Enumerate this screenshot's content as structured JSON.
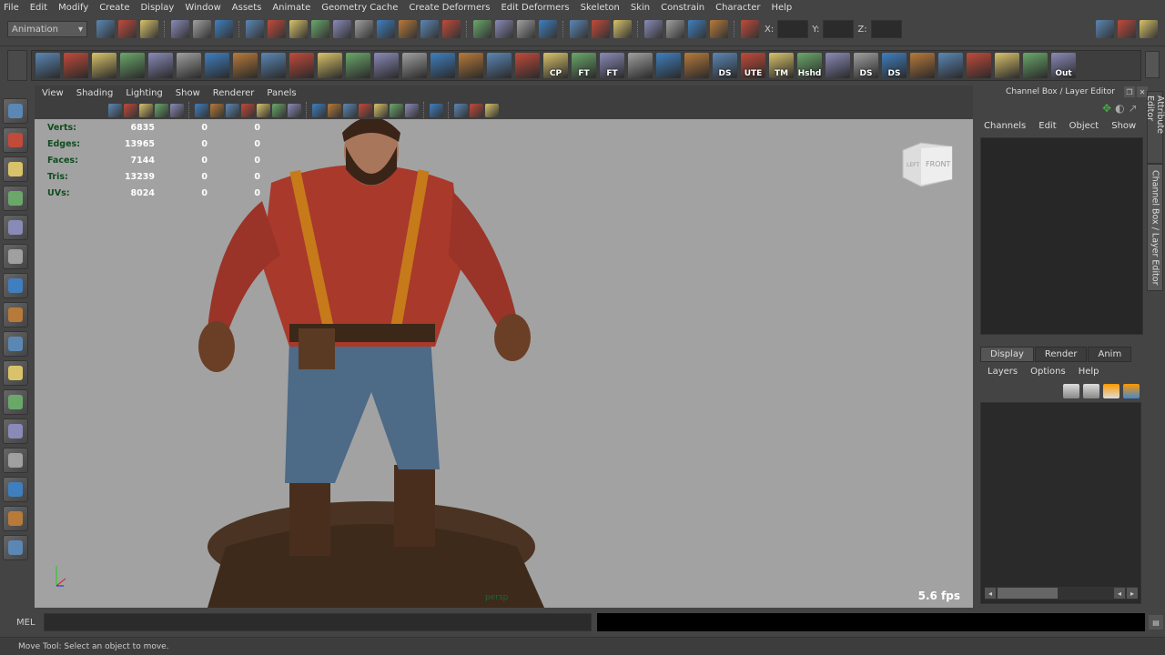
{
  "menubar": [
    "File",
    "Edit",
    "Modify",
    "Create",
    "Display",
    "Window",
    "Assets",
    "Animate",
    "Geometry Cache",
    "Create Deformers",
    "Edit Deformers",
    "Skeleton",
    "Skin",
    "Constrain",
    "Character",
    "Help"
  ],
  "statusline": {
    "menuset": "Animation",
    "icons": [
      "new-scene-icon",
      "open-scene-icon",
      "save-scene-icon",
      "|",
      "select-hierarchy-icon",
      "select-object-icon",
      "select-component-icon",
      "|",
      "snap-grid-icon",
      "snap-curve-icon",
      "snap-point-icon",
      "snap-surface-icon",
      "snap-view-icon",
      "snap-live-icon",
      "snap-vertex-icon",
      "help-query-icon",
      "lock-icon",
      "select-highlight-icon",
      "|",
      "magnet-icon",
      "magnet-curve-icon",
      "magnet-point-icon",
      "magnet-surface-icon",
      "|",
      "input-ops-icon",
      "output-ops-icon",
      "construction-history-icon",
      "|",
      "render-view-icon",
      "render-icon",
      "ipr-render-icon",
      "render-settings-icon",
      "|",
      "transform-field-icon"
    ],
    "x_label": "X:",
    "y_label": "Y:",
    "z_label": "Z:",
    "right_icons": [
      "attribute-editor-toggle-icon",
      "tool-settings-toggle-icon",
      "channel-box-toggle-icon"
    ]
  },
  "shelf": {
    "items": [
      {
        "icon": "camera-search-icon",
        "label": ""
      },
      {
        "icon": "help-icon",
        "label": ""
      },
      {
        "icon": "camera-orbit-icon",
        "label": ""
      },
      {
        "icon": "camera-move-icon",
        "label": ""
      },
      {
        "icon": "camera-pan-icon",
        "label": ""
      },
      {
        "icon": "camera-dolly-icon",
        "label": ""
      },
      {
        "icon": "undo-red-icon",
        "label": ""
      },
      {
        "icon": "redo-green-icon",
        "label": ""
      },
      {
        "icon": "delete-history-icon",
        "label": ""
      },
      {
        "icon": "hierarchy-1-icon",
        "label": ""
      },
      {
        "icon": "hierarchy-2-icon",
        "label": ""
      },
      {
        "icon": "hierarchy-3-icon",
        "label": ""
      },
      {
        "icon": "hierarchy-4-icon",
        "label": ""
      },
      {
        "icon": "node-editor-icon",
        "label": ""
      },
      {
        "icon": "select-red-icon",
        "label": ""
      },
      {
        "icon": "select-cube-icon",
        "label": ""
      },
      {
        "icon": "select-grid-icon",
        "label": ""
      },
      {
        "icon": "paint-brush-icon",
        "label": ""
      },
      {
        "icon": "axis-cp-icon",
        "label": "CP"
      },
      {
        "icon": "axis-ft-icon",
        "label": "FT"
      },
      {
        "icon": "axis-ft2-icon",
        "label": "FT"
      },
      {
        "icon": "cylinder-arrow-icon",
        "label": ""
      },
      {
        "icon": "cylinder-arrow2-icon",
        "label": ""
      },
      {
        "icon": "cube-arrow-icon",
        "label": ""
      },
      {
        "icon": "pencil-ds-icon",
        "label": "DS"
      },
      {
        "icon": "window-ute-icon",
        "label": "UTE"
      },
      {
        "icon": "sphere-tm-icon",
        "label": "TM"
      },
      {
        "icon": "window-hshd-icon",
        "label": "Hshd"
      },
      {
        "icon": "split-plane-icon",
        "label": ""
      },
      {
        "icon": "pencil-ds2-icon",
        "label": "DS"
      },
      {
        "icon": "pencil-ds3-icon",
        "label": "DS"
      },
      {
        "icon": "uv-tile-icon",
        "label": ""
      },
      {
        "icon": "uv-select-icon",
        "label": ""
      },
      {
        "icon": "uv-grid-delete-icon",
        "label": ""
      },
      {
        "icon": "uv-seam-icon",
        "label": ""
      },
      {
        "icon": "uv-project-icon",
        "label": ""
      },
      {
        "icon": "window-out-icon",
        "label": "Out"
      }
    ]
  },
  "toolbox": [
    "select-tool-icon",
    "lasso-tool-icon",
    "paint-select-icon",
    "move-tool-icon",
    "rotate-tool-icon",
    "scale-tool-icon",
    "manipulator-icon",
    "soft-mod-icon",
    "last-tool-icon",
    "|",
    "single-pane-icon",
    "four-pane-icon",
    "outliner-pane-icon",
    "graph-pane-icon",
    "hypershade-pane-icon",
    "uv-pane-icon",
    "maya-logo-icon"
  ],
  "viewport": {
    "menu": [
      "View",
      "Shading",
      "Lighting",
      "Show",
      "Renderer",
      "Panels"
    ],
    "icons": [
      "camera-attr-icon",
      "bookmark-icon",
      "image-plane-icon",
      "grid-icon",
      "film-gate-icon",
      "|",
      "wireframe-icon",
      "shaded-icon",
      "smooth-shade-icon",
      "wire-on-shaded-icon",
      "xray-icon",
      "texture-icon",
      "textured-icon",
      "|",
      "cube-wire-icon",
      "cube-solid-icon",
      "cube-shaded-icon",
      "checker-icon",
      "light-default-icon",
      "light-all-icon",
      "light-gold-icon",
      "|",
      "isolate-select-icon",
      "|",
      "camera-lock-icon",
      "split-view-icon",
      "share-icon"
    ],
    "hud": [
      {
        "label": "Verts:",
        "values": [
          "6835",
          "0",
          "0"
        ]
      },
      {
        "label": "Edges:",
        "values": [
          "13965",
          "0",
          "0"
        ]
      },
      {
        "label": "Faces:",
        "values": [
          "7144",
          "0",
          "0"
        ]
      },
      {
        "label": "Tris:",
        "values": [
          "13239",
          "0",
          "0"
        ]
      },
      {
        "label": "UVs:",
        "values": [
          "8024",
          "0",
          "0"
        ]
      }
    ],
    "viewcube": {
      "left": "LEFT",
      "front": "FRONT"
    },
    "camera": "persp",
    "fps": "5.6 fps"
  },
  "right_panel": {
    "title": "Channel Box / Layer Editor",
    "menu": [
      "Channels",
      "Edit",
      "Object",
      "Show"
    ],
    "layer_tabs": [
      "Display",
      "Render",
      "Anim"
    ],
    "active_tab": "Display",
    "layer_menu": [
      "Layers",
      "Options",
      "Help"
    ],
    "vertical_tabs": [
      "Attribute Editor",
      "Channel Box / Layer Editor"
    ]
  },
  "mel": {
    "label": "MEL",
    "value": ""
  },
  "status": "Move Tool: Select an object to move.",
  "colors": {
    "bg": "#444444",
    "viewport": "#a2a2a2",
    "hud_label": "#0e4d1e"
  }
}
